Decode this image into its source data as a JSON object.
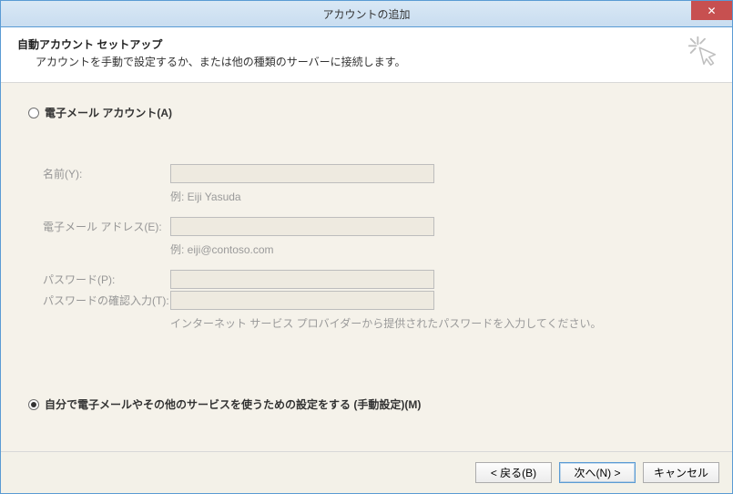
{
  "window": {
    "title": "アカウントの追加",
    "close_tooltip": "閉じる"
  },
  "header": {
    "heading": "自動アカウント セットアップ",
    "subheading": "アカウントを手動で設定するか、または他の種類のサーバーに接続します。"
  },
  "options": {
    "email_account_label": "電子メール アカウント(A)",
    "manual_setup_label": "自分で電子メールやその他のサービスを使うための設定をする (手動設定)(M)"
  },
  "form": {
    "name_label": "名前(Y):",
    "name_value": "",
    "name_hint": "例: Eiji Yasuda",
    "email_label": "電子メール アドレス(E):",
    "email_value": "",
    "email_hint": "例: eiji@contoso.com",
    "password_label": "パスワード(P):",
    "password_value": "",
    "password_confirm_label": "パスワードの確認入力(T):",
    "password_confirm_value": "",
    "password_hint": "インターネット サービス プロバイダーから提供されたパスワードを入力してください。"
  },
  "footer": {
    "back_label": "< 戻る(B)",
    "next_label": "次へ(N) >",
    "cancel_label": "キャンセル"
  }
}
